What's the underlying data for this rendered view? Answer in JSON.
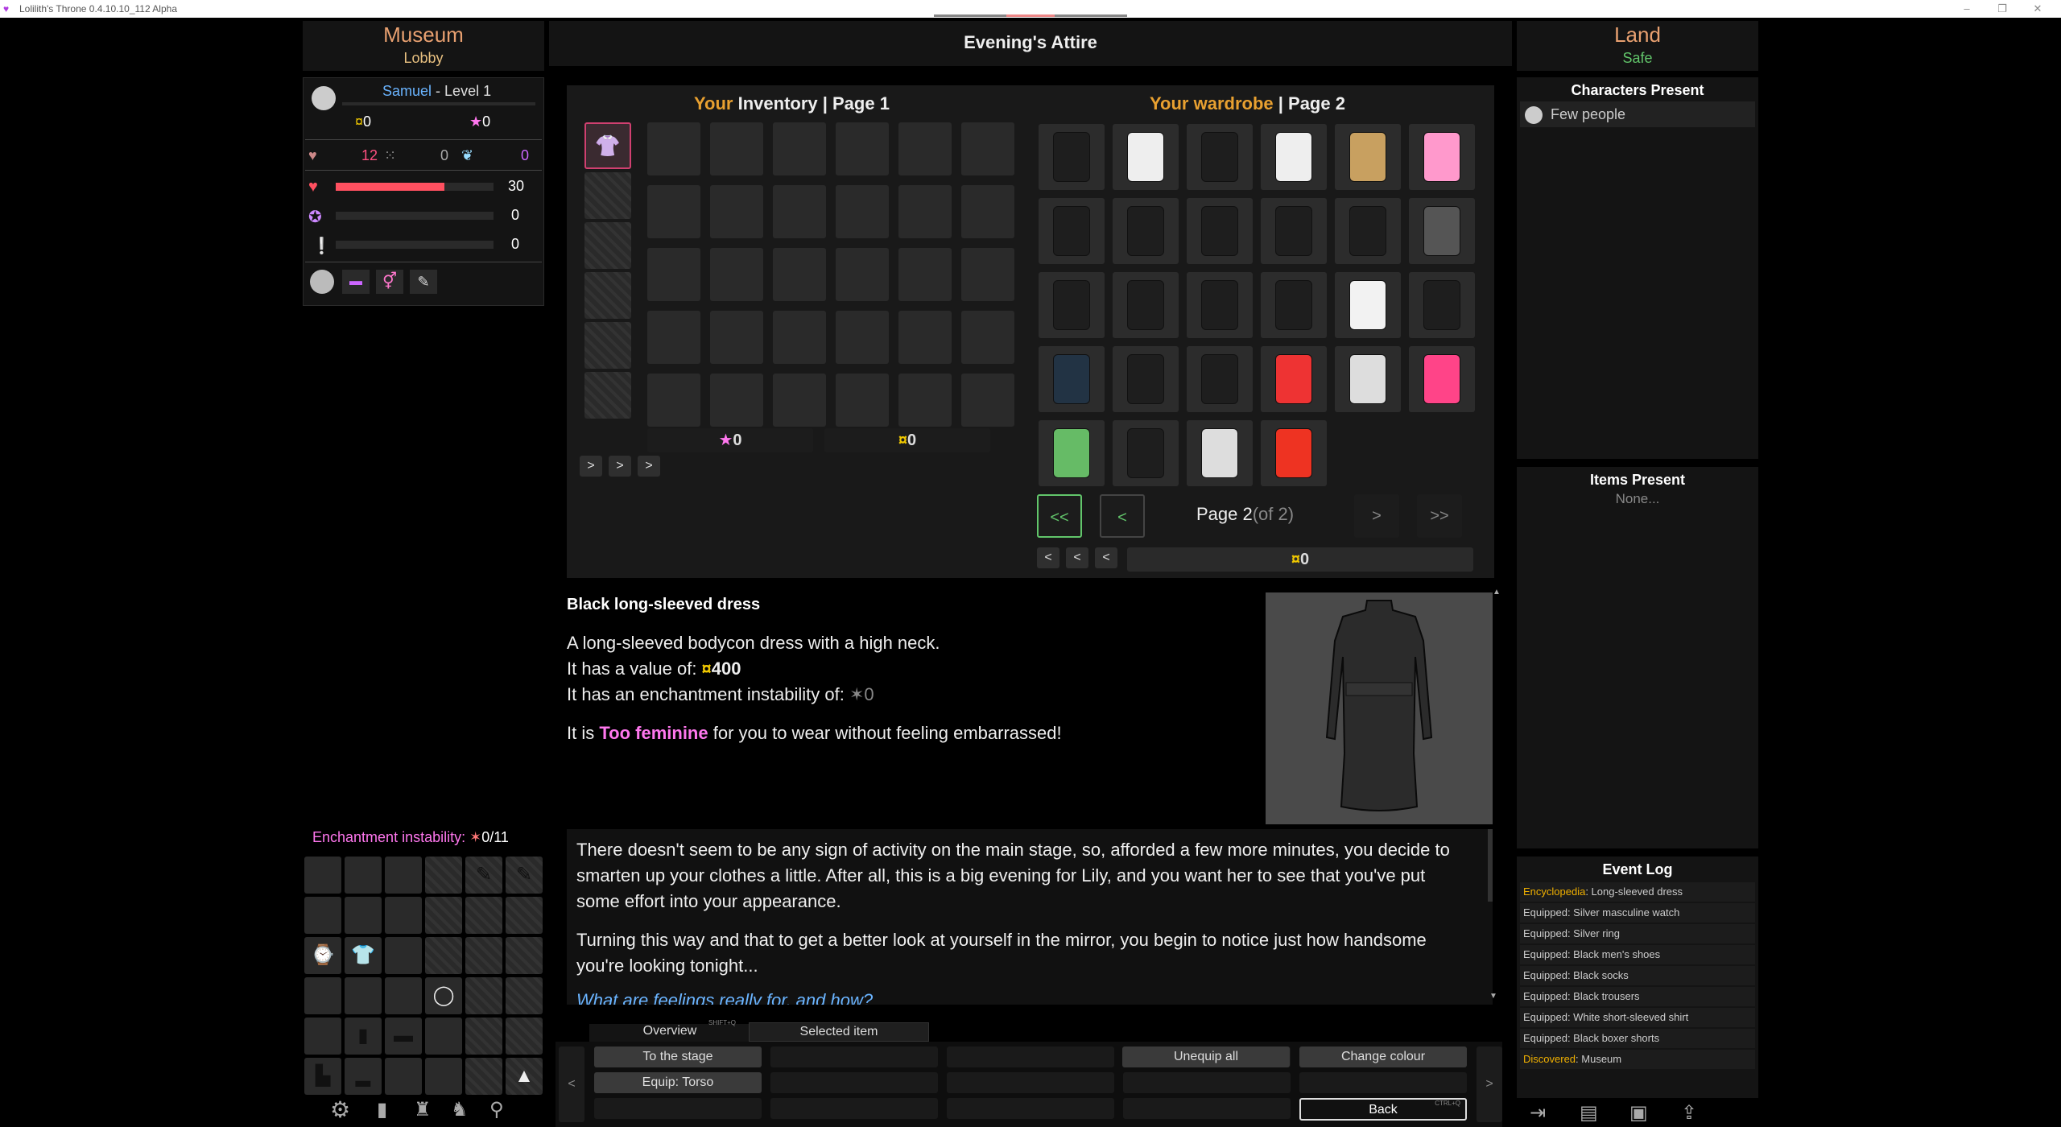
{
  "titlebar": {
    "title": "Lolilith's Throne 0.4.10.10_112 Alpha"
  },
  "location": {
    "place": "Museum",
    "area": "Lobby"
  },
  "header": {
    "title": "Evening's Attire"
  },
  "right_location": {
    "place": "Land",
    "status": "Safe"
  },
  "player": {
    "name": "Samuel",
    "level": "- Level 1",
    "money": "0",
    "essence": "0",
    "stat1": "12",
    "stat2": "0",
    "stat3": "0",
    "health": "30",
    "health_fraction": 0.69,
    "mana": "0",
    "lust": "0"
  },
  "inventory": {
    "title_your": "Your",
    "title_rest": "Inventory | Page 1",
    "essence_total": "0",
    "money_total": "0",
    "nav": [
      ">",
      ">",
      ">"
    ]
  },
  "wardrobe": {
    "title_your": "Your wardrobe",
    "title_rest": "| Page 2",
    "page_label": "Page 2",
    "page_of": "(of 2)",
    "first": "<<",
    "prev": "<",
    "next": ">",
    "last": ">>",
    "money_total": "0",
    "nav": [
      "<",
      "<",
      "<"
    ],
    "items": [
      "black-skirt-icon",
      "white-sneakers-icon",
      "black-pencil-skirt-icon",
      "white-stockings-icon",
      "tan-boots-icon",
      "pink-sneakers-icon",
      "black-top-icon",
      "black-thong-icon",
      "black-pleated-skirt-icon",
      "black-headband-icon",
      "black-suit-jacket-icon",
      "grey-sweater-icon",
      "black-scarf-icon",
      "black-hoodie-icon",
      "black-peacoat-icon",
      "black-trench-coat-icon",
      "white-briefs-icon",
      "black-heels-icon",
      "blue-jeans-icon",
      "black-ankle-boots-icon",
      "black-thigh-highs-icon",
      "red-bra-icon",
      "white-shorts-icon",
      "pink-top-icon",
      "green-cami-icon",
      "black-slip-dress-icon",
      "white-sweater-icon",
      "red-dress-icon"
    ]
  },
  "item_desc": {
    "name": "Black long-sleeved dress",
    "line1": "A long-sleeved bodycon dress with a high neck.",
    "value_prefix": "It has a value of: ",
    "value": "400",
    "instab_prefix": "It has an enchantment instability of: ",
    "instab_value": "0",
    "fem_prefix": "It is ",
    "fem_highlight": "Too feminine",
    "fem_suffix": " for you to wear without feeling embarrassed!"
  },
  "story": {
    "p1": "There doesn't seem to be any sign of activity on the main stage, so, afforded a few more minutes, you decide to smarten up your clothes a little. After all, this is a big evening for Lily, and you want her to see that you've put some effort into your appearance.",
    "p2": "Turning this way and that to get a better look at yourself in the mirror, you begin to notice just how handsome you're looking tonight...",
    "p3": "What are feelings really for, and how?"
  },
  "tabs": {
    "overview": "Overview",
    "overview_key": "SHIFT+Q",
    "selected": "Selected item"
  },
  "actions": {
    "to_stage": "To the stage",
    "equip_torso": "Equip: Torso",
    "unequip_all": "Unequip all",
    "change_colour": "Change colour",
    "back": "Back",
    "back_key": "CTRL+Q",
    "left_arrow": "<",
    "right_arrow": ">"
  },
  "enchantment": {
    "label": "Enchantment instability:",
    "value": "0/11"
  },
  "characters": {
    "title": "Characters Present",
    "entry": "Few people"
  },
  "items_present": {
    "title": "Items Present",
    "none": "None..."
  },
  "event_log": {
    "title": "Event Log",
    "entries": [
      {
        "tag": "Encyclopedia",
        "text": ": Long-sleeved dress"
      },
      {
        "tag": "",
        "text": "Equipped: Silver masculine watch"
      },
      {
        "tag": "",
        "text": "Equipped: Silver ring"
      },
      {
        "tag": "",
        "text": "Equipped: Black men's shoes"
      },
      {
        "tag": "",
        "text": "Equipped: Black socks"
      },
      {
        "tag": "",
        "text": "Equipped: Black trousers"
      },
      {
        "tag": "",
        "text": "Equipped: White short-sleeved shirt"
      },
      {
        "tag": "",
        "text": "Equipped: Black boxer shorts"
      },
      {
        "tag": "Discovered",
        "text": ": Museum"
      }
    ]
  },
  "colors": {
    "place": "#e8a070",
    "header_orange": "#e8a030",
    "blue_name": "#6ab4ff",
    "pink": "#ff77ee",
    "gold": "#f0c800",
    "green": "#62c66b",
    "health_bar": "#ff5060"
  }
}
